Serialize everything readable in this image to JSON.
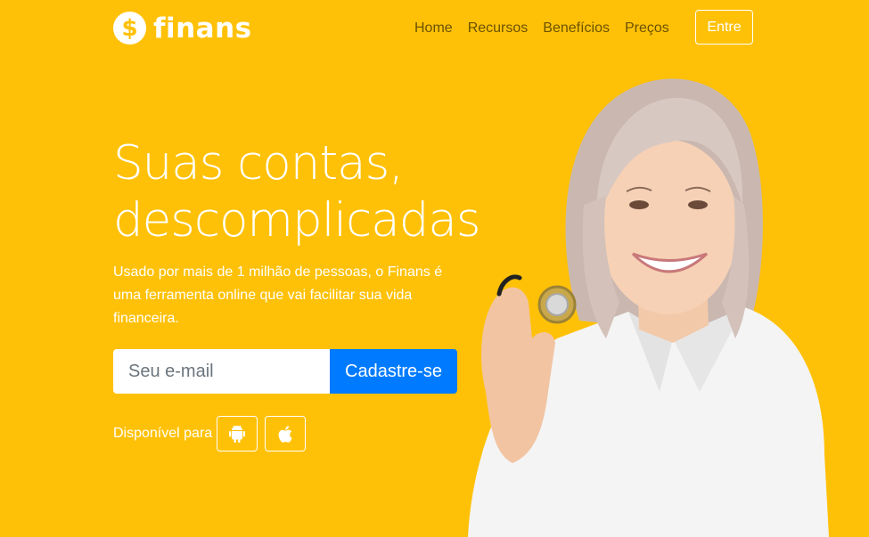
{
  "brand": {
    "logo_symbol": "$",
    "name": "finans"
  },
  "nav": {
    "items": [
      "Home",
      "Recursos",
      "Benefícios",
      "Preços"
    ]
  },
  "header": {
    "login_label": "Entre"
  },
  "hero": {
    "headline_line1": "Suas contas,",
    "headline_line2": "descomplicadas",
    "subtext": "Usado por mais de 1 milhão de pessoas, o Finans é uma ferramenta online que vai facilitar sua vida financeira.",
    "email_placeholder": "Seu e-mail",
    "signup_label": "Cadastre-se",
    "available_label": "Disponível para"
  },
  "icons": {
    "android": "android-icon",
    "apple": "apple-icon"
  },
  "colors": {
    "background": "#ffc107",
    "primary_button": "#007bff",
    "nav_text": "#6b5200"
  }
}
